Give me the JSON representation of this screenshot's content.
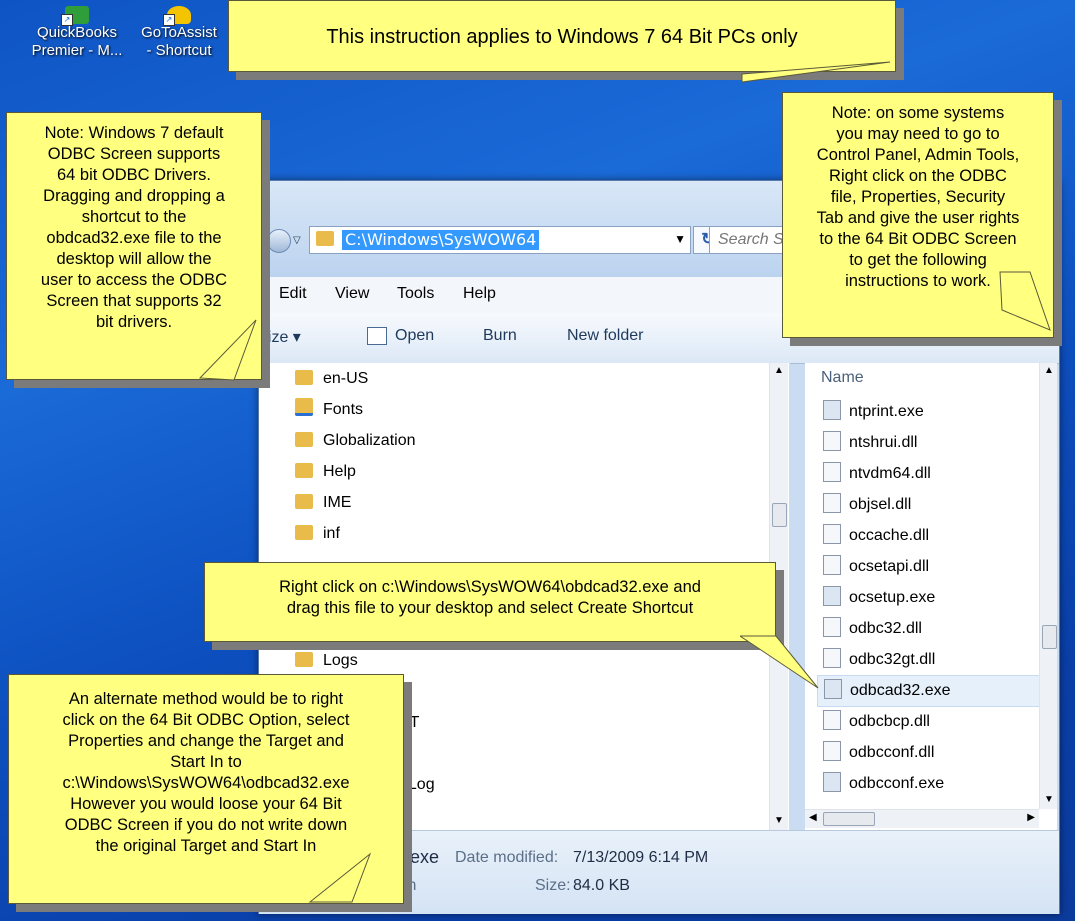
{
  "desktop": {
    "icons": [
      {
        "line1": "QuickBooks",
        "line2": "Premier - M..."
      },
      {
        "line1": "GoToAssist",
        "line2": "- Shortcut"
      }
    ]
  },
  "window": {
    "address_path": "C:\\Windows\\SysWOW64",
    "search_placeholder": "Search S",
    "menu": [
      "Edit",
      "View",
      "Tools",
      "Help"
    ],
    "toolbar": {
      "organize": "nize ▾",
      "open": "Open",
      "burn": "Burn",
      "new_folder": "New folder"
    },
    "folders": [
      "en-US",
      "Fonts",
      "Globalization",
      "Help",
      "IME",
      "inf",
      "Logs"
    ],
    "folders_partial": [
      "ET",
      "s",
      "_Log"
    ],
    "column_name": "Name",
    "files": [
      "ntprint.exe",
      "ntshrui.dll",
      "ntvdm64.dll",
      "objsel.dll",
      "occache.dll",
      "ocsetapi.dll",
      "ocsetup.exe",
      "odbc32.dll",
      "odbc32gt.dll",
      "odbcad32.exe",
      "odbcbcp.dll",
      "odbcconf.dll",
      "odbcconf.exe"
    ],
    "selected_file": "odbcad32.exe",
    "details": {
      "name_partial": "2.exe",
      "date_label": "Date modified:",
      "date_value": "7/13/2009 6:14 PM",
      "type_partial": "ion",
      "size_label": "Size:",
      "size_value": "84.0 KB"
    }
  },
  "notes": {
    "top": "This instruction applies to Windows 7 64 Bit PCs only",
    "left": [
      "Note: Windows 7 default",
      "ODBC Screen supports",
      "64 bit ODBC Drivers.",
      "Dragging and dropping a",
      "shortcut to the",
      "obdcad32.exe file to the",
      "desktop will allow the",
      "user to access the ODBC",
      "Screen that supports 32",
      "bit drivers."
    ],
    "right": [
      "Note: on some systems",
      "you may need to go to",
      "Control Panel, Admin Tools,",
      "Right click on the ODBC",
      "file, Properties, Security",
      "Tab and give the user rights",
      "to the 64 Bit ODBC Screen",
      "to get the following",
      "instructions to work."
    ],
    "middle": [
      "Right click on c:\\Windows\\SysWOW64\\obdcad32.exe and",
      "drag this file to your desktop and select Create Shortcut"
    ],
    "bottom": [
      "An alternate method would be to right",
      "click on the 64 Bit ODBC Option, select",
      "Properties and change the Target and",
      "Start In to",
      "c:\\Windows\\SysWOW64\\odbcad32.exe",
      "However you would loose your 64 Bit",
      "ODBC Screen if you do not write down",
      "the original Target and Start In"
    ]
  }
}
